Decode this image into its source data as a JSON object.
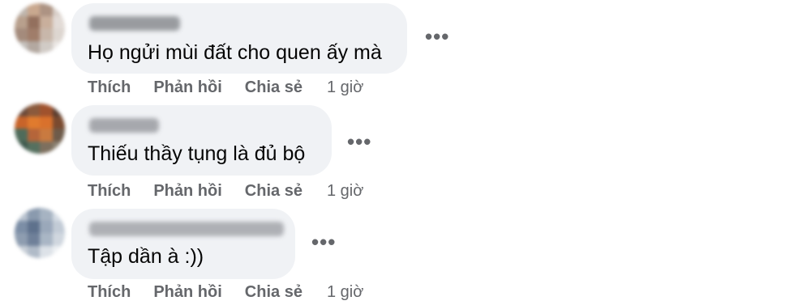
{
  "comments": [
    {
      "text": "Họ ngửi mùi đất cho quen ấy mà",
      "more_label": "•••",
      "like_label": "Thích",
      "reply_label": "Phản hồi",
      "share_label": "Chia sẻ",
      "time": "1 giờ",
      "name_color": "#8a8d91",
      "avatar_colors": [
        "#bfb6ae",
        "#c9a88f",
        "#ad9383",
        "#d8cfc8",
        "#b8a08d",
        "#93705e",
        "#c9af9c",
        "#e2dbd6",
        "#a48b7c",
        "#a07d6a",
        "#c8b7aa",
        "#ddd6d0",
        "#c4c0bc",
        "#b3a8a0",
        "#d1cbc6",
        "#ebe7e4"
      ]
    },
    {
      "text": "Thiếu thầy tụng là đủ bộ",
      "more_label": "•••",
      "like_label": "Thích",
      "reply_label": "Phản hồi",
      "share_label": "Chia sẻ",
      "time": "1 giờ",
      "name_color": "#9a9ca1",
      "avatar_colors": [
        "#6b4a3a",
        "#8b5a3c",
        "#a0522d",
        "#5a3d2e",
        "#c8642a",
        "#e07b2e",
        "#d9712c",
        "#7a4a2f",
        "#4f6b5a",
        "#b5653a",
        "#c97a40",
        "#6e5b4a",
        "#3f5a4e",
        "#56705f",
        "#7d6f5e",
        "#8c8272"
      ]
    },
    {
      "text": "Tập dần à :))",
      "more_label": "•••",
      "like_label": "Thích",
      "reply_label": "Phản hồi",
      "share_label": "Chia sẻ",
      "time": "1 giờ",
      "name_color": "#a3a5aa",
      "avatar_colors": [
        "#b9c3cf",
        "#8a9aae",
        "#a6b3c2",
        "#d5dce4",
        "#7c8ea6",
        "#5e718c",
        "#9aa8ba",
        "#c2cbd6",
        "#8e9db0",
        "#6f8099",
        "#a9b6c5",
        "#d0d7df",
        "#c9d0d8",
        "#b0bbc8",
        "#dde2e8",
        "#eef1f4"
      ]
    }
  ]
}
